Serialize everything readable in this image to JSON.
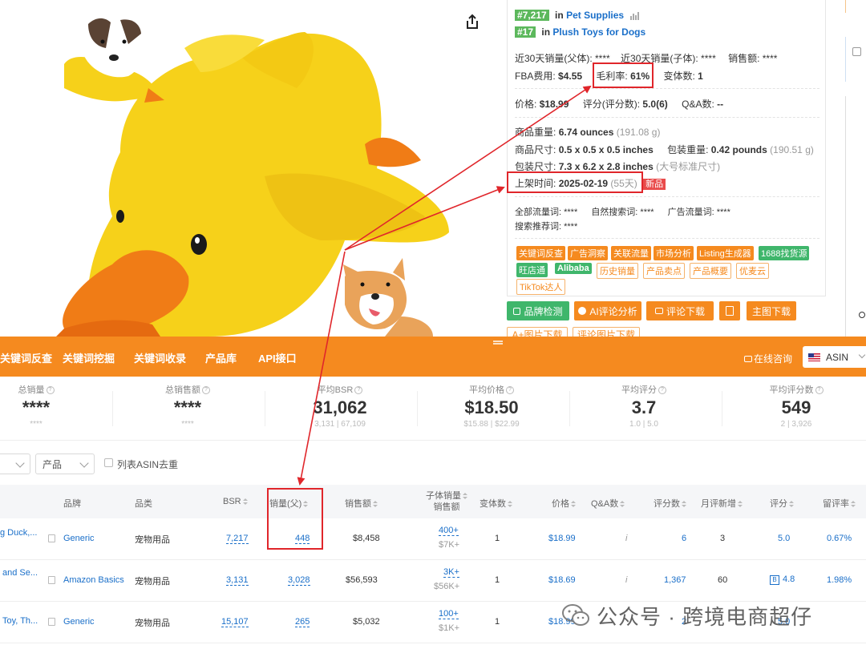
{
  "product": {
    "ranks": [
      {
        "rank": "#7,217",
        "prefix": "in",
        "category": "Pet Supplies"
      },
      {
        "rank": "#17",
        "prefix": "in",
        "category": "Plush Toys for Dogs"
      }
    ],
    "sales_30d_parent": "近30天销量(父体): ****",
    "sales_30d_child": "近30天销量(子体): ****",
    "sales_amount": "销售额: ****",
    "fba_fee_label": "FBA费用:",
    "fba_fee": "$4.55",
    "margin_label": "毛利率:",
    "margin": "61%",
    "variants_label": "变体数:",
    "variants": "1",
    "price_label": "价格:",
    "price": "$18.99",
    "rating_label": "评分(评分数):",
    "rating": "5.0(6)",
    "qa_label": "Q&A数:",
    "qa": "--",
    "item_weight_label": "商品重量:",
    "item_weight": "6.74 ounces",
    "item_weight_alt": "(191.08 g)",
    "item_size_label": "商品尺寸:",
    "item_size": "0.5 x 0.5 x 0.5 inches",
    "pkg_weight_label": "包装重量:",
    "pkg_weight": "0.42 pounds",
    "pkg_weight_alt": "(190.51 g)",
    "pkg_size_label": "包装尺寸:",
    "pkg_size": "7.3 x 6.2 x 2.8 inches",
    "pkg_size_alt": "(大号标准尺寸)",
    "launch_label": "上架时间:",
    "launch_date": "2025-02-19",
    "launch_days": "(55天)",
    "new_badge": "新品",
    "traffic_all": "全部流量词: ****",
    "traffic_natural": "自然搜索词: ****",
    "traffic_ad": "广告流量词: ****",
    "traffic_recommend": "搜索推荐词: ****",
    "tags_row1": [
      "关键词反查",
      "广告洞察",
      "关联流量",
      "市场分析",
      "Listing生成器",
      "1688找货源"
    ],
    "tags_row2": [
      "旺店通",
      "Alibaba",
      "历史销量",
      "产品卖点",
      "产品概要",
      "优麦云"
    ],
    "tags_row3": [
      "TikTok达人"
    ],
    "buttons": [
      "品牌检测",
      "AI评论分析",
      "评论下载",
      "主图下载"
    ],
    "buttons_row2": [
      "A+图片下载",
      "评论图片下载"
    ]
  },
  "nav": {
    "items": [
      "关键词反查",
      "关键词挖掘",
      "关键词收录",
      "产品库",
      "API接口"
    ],
    "consult": "在线咨询",
    "asin_select": "ASIN"
  },
  "stats": [
    {
      "label": "总销量",
      "value": "****",
      "sub": "****"
    },
    {
      "label": "总销售额",
      "value": "****",
      "sub": "****"
    },
    {
      "label": "平均BSR",
      "value": "31,062",
      "sub": "3,131 | 67,109"
    },
    {
      "label": "平均价格",
      "value": "$18.50",
      "sub": "$15.88 | $22.99"
    },
    {
      "label": "平均评分",
      "value": "3.7",
      "sub": "1.0 | 5.0"
    },
    {
      "label": "平均评分数",
      "value": "549",
      "sub": "2 | 3,926"
    }
  ],
  "filters": {
    "select2": "产品",
    "dedupe_label": "列表ASIN去重"
  },
  "table": {
    "headers": {
      "brand": "品牌",
      "category": "品类",
      "bsr": "BSR",
      "sales": "销量(父)",
      "revenue": "销售额",
      "child_sales_1": "子体销量",
      "child_sales_2": "销售额",
      "variants": "变体数",
      "price": "价格",
      "qa": "Q&A数",
      "reviews": "评分数",
      "monthly_new": "月评新增",
      "rating": "评分",
      "retention": "留评率"
    },
    "rows": [
      {
        "title": "g Duck,...",
        "brand": "Generic",
        "category": "宠物用品",
        "bsr": "7,217",
        "sales": "448",
        "revenue": "$8,458",
        "child_sales": "400+",
        "child_revenue": "$7K+",
        "variants": "1",
        "price": "$18.99",
        "qa": "i",
        "reviews": "6",
        "monthly_new": "3",
        "rating": "5.0",
        "retention": "0.67%"
      },
      {
        "title": "and Se...",
        "brand": "Amazon Basics",
        "category": "宠物用品",
        "bsr": "3,131",
        "sales": "3,028",
        "revenue": "$56,593",
        "child_sales": "3K+",
        "child_revenue": "$56K+",
        "variants": "1",
        "price": "$18.69",
        "qa": "i",
        "reviews": "1,367",
        "monthly_new": "60",
        "rating": "4.8",
        "retention": "1.98%"
      },
      {
        "title": "Toy, Th...",
        "brand": "Generic",
        "category": "宠物用品",
        "bsr": "15,107",
        "sales": "265",
        "revenue": "$5,032",
        "child_sales": "100+",
        "child_revenue": "$1K+",
        "variants": "1",
        "price": "$18.99",
        "qa": "",
        "reviews": "2",
        "monthly_new": "",
        "rating": "5.0",
        "retention": ""
      }
    ]
  },
  "watermark": "公众号 · 跨境电商超仔",
  "colors": {
    "accent": "#f58a1f",
    "link": "#1a6fc9",
    "rank_green": "#5cb85c",
    "annotation_red": "#e0262b"
  }
}
